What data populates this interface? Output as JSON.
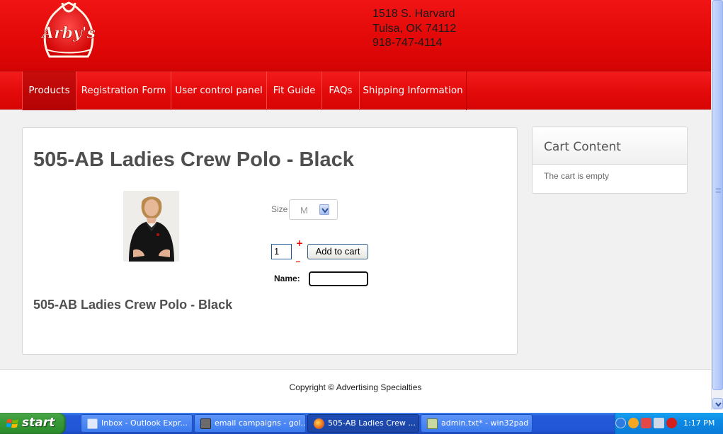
{
  "header": {
    "brand": "Arby's",
    "address_lines": [
      "1518 S. Harvard",
      "Tulsa, OK 74112",
      "918-747-4114"
    ]
  },
  "nav": {
    "items": [
      {
        "label": "Products",
        "active": true
      },
      {
        "label": "Registration Form",
        "active": false
      },
      {
        "label": "User control panel",
        "active": false
      },
      {
        "label": "Fit Guide",
        "active": false
      },
      {
        "label": "FAQs",
        "active": false
      },
      {
        "label": "Shipping Information",
        "active": false
      }
    ]
  },
  "product": {
    "title": "505-AB Ladies Crew Polo - Black",
    "size_label": "Size",
    "size_value": "M",
    "quantity": "1",
    "plus_symbol": "+",
    "minus_symbol": "_",
    "add_to_cart_label": "Add to cart",
    "name_label": "Name:",
    "name_value": "",
    "subtitle": "505-AB Ladies Crew Polo - Black"
  },
  "cart": {
    "title": "Cart Content",
    "status": "The cart is empty"
  },
  "footer": {
    "copyright": "Copyright © Advertising Specialties"
  },
  "taskbar": {
    "start_label": "start",
    "tasks": [
      {
        "label": "Inbox - Outlook Expr...",
        "active": false
      },
      {
        "label": "email campaigns - gol...",
        "active": false
      },
      {
        "label": "505-AB Ladies Crew ...",
        "active": true
      },
      {
        "label": "admin.txt* - win32pad",
        "active": false
      }
    ],
    "clock": "1:17 PM"
  },
  "colors": {
    "brand_red": "#e50a0a",
    "taskbar_blue": "#2157d6",
    "start_green": "#379a37"
  }
}
